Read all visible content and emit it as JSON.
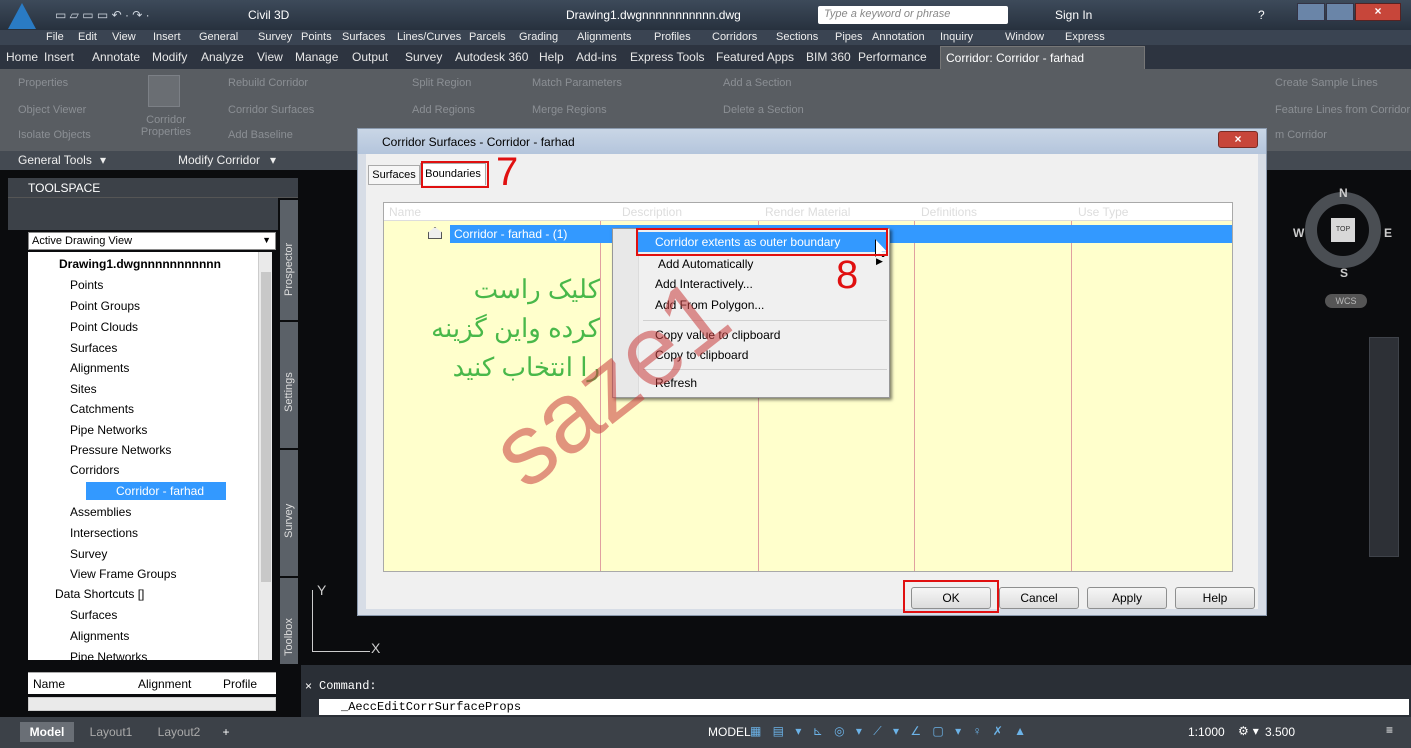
{
  "app": {
    "title": "Drawing1.dwgnnnnnnnnnnn.dwg",
    "workspace": "Civil 3D",
    "search_placeholder": "Type a keyword or phrase",
    "sign_in": "Sign In"
  },
  "menubar": [
    "File",
    "Edit",
    "View",
    "Insert",
    "General",
    "Survey",
    "Points",
    "Surfaces",
    "Lines/Curves",
    "Parcels",
    "Grading",
    "Alignments",
    "Profiles",
    "Corridors",
    "Sections",
    "Pipes",
    "Annotation",
    "Inquiry",
    "Window",
    "Express"
  ],
  "ribbon_tabs": [
    "Home",
    "Insert",
    "Annotate",
    "Modify",
    "Analyze",
    "View",
    "Manage",
    "Output",
    "Survey",
    "Autodesk 360",
    "Help",
    "Add-ins",
    "Express Tools",
    "Featured Apps",
    "BIM 360",
    "Performance",
    "Corridor: Corridor - farhad"
  ],
  "ribbon": {
    "properties": "Properties",
    "object_viewer": "Object Viewer",
    "isolate_objects": "Isolate Objects",
    "corridor_properties": "Corridor Properties",
    "rebuild_corridor": "Rebuild Corridor",
    "corridor_surfaces": "Corridor Surfaces",
    "add_baseline": "Add Baseline",
    "split_region": "Split Region",
    "add_regions": "Add Regions",
    "match_parameters": "Match Parameters",
    "merge_regions": "Merge Regions",
    "add_section": "Add a Section",
    "delete_section": "Delete a Section",
    "create_sample_lines": "Create Sample Lines",
    "feature_lines": "Feature Lines from Corridor",
    "from_corridor": "m Corridor",
    "general_tools": "General Tools",
    "modify_corridor": "Modify Corridor"
  },
  "toolspace": {
    "title": "TOOLSPACE",
    "view": "Active Drawing View",
    "tabs": [
      "Prospector",
      "Settings",
      "Survey",
      "Toolbox"
    ],
    "tree": [
      "Drawing1.dwgnnnnnnnnnnn",
      "Points",
      "Point Groups",
      "Point Clouds",
      "Surfaces",
      "Alignments",
      "Sites",
      "Catchments",
      "Pipe Networks",
      "Pressure Networks",
      "Corridors",
      "Corridor - farhad",
      "Assemblies",
      "Intersections",
      "Survey",
      "View Frame Groups",
      "Data Shortcuts []",
      "Surfaces",
      "Alignments",
      "Pipe Networks"
    ],
    "list_headers": [
      "Name",
      "Alignment",
      "Profile"
    ]
  },
  "dialog": {
    "title": "Corridor Surfaces - Corridor - farhad",
    "tabs": [
      "Surfaces",
      "Boundaries"
    ],
    "columns": [
      "Name",
      "Description",
      "Render Material",
      "Definitions",
      "Use Type"
    ],
    "row": "Corridor - farhad - (1)",
    "buttons": {
      "ok": "OK",
      "cancel": "Cancel",
      "apply": "Apply",
      "help": "Help"
    }
  },
  "context_menu": [
    "Corridor extents as outer boundary",
    "Add Automatically",
    "Add Interactively...",
    "Add From Polygon...",
    "Copy value to clipboard",
    "Copy to clipboard",
    "Refresh"
  ],
  "annotations": {
    "step7": "7",
    "step8": "8",
    "persian": [
      "کلیک راست",
      "کرده واین گزینه",
      "را انتخاب کنید"
    ]
  },
  "watermark": "saze1",
  "compass": {
    "n": "N",
    "s": "S",
    "e": "E",
    "w": "W",
    "top": "TOP",
    "wcs": "WCS"
  },
  "command": {
    "label": "Command:",
    "prompt": "_AeccEditCorrSurfaceProps"
  },
  "status": {
    "tabs": [
      "Model",
      "Layout1",
      "Layout2",
      "+"
    ],
    "model": "MODEL",
    "scale": "1:1000",
    "value": "3.500"
  },
  "axes": {
    "x": "X",
    "y": "Y"
  }
}
